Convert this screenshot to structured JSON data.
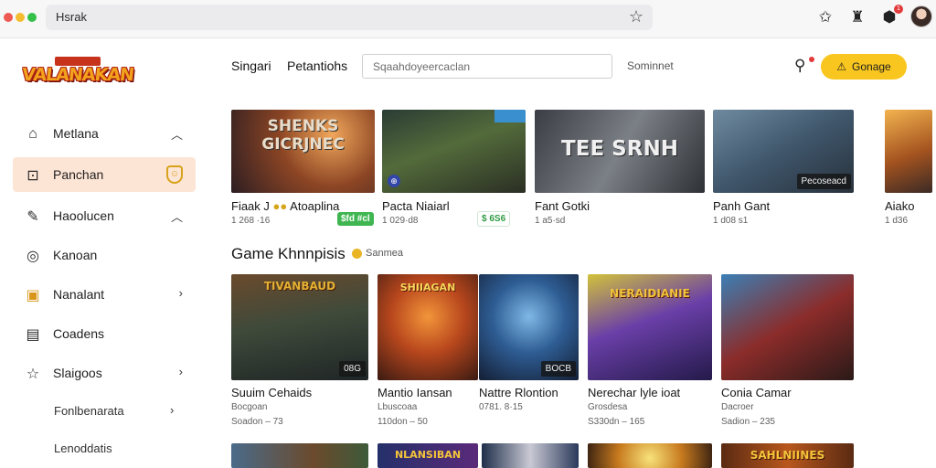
{
  "browser": {
    "url": "Hsrak",
    "notification_count": "1"
  },
  "logo": {
    "text": "VALANAKAN"
  },
  "sidebar": {
    "items": [
      {
        "label": "Metlana",
        "icon": "home-icon",
        "chevron": "up"
      },
      {
        "label": "Panchan",
        "icon": "bookmark-icon",
        "active": true,
        "badge_icon": "shield-icon"
      },
      {
        "label": "Haoolucen",
        "icon": "pen-icon",
        "chevron": "up"
      },
      {
        "label": "Kanoan",
        "icon": "disc-icon"
      },
      {
        "label": "Nanalant",
        "icon": "info-icon",
        "chevron": "right"
      },
      {
        "label": "Coadens",
        "icon": "document-icon"
      },
      {
        "label": "Slaigoos",
        "icon": "star-icon",
        "chevron": "right"
      }
    ],
    "subitems": [
      {
        "label": "Fonlbenarata",
        "chevron": "right"
      },
      {
        "label": "Lenoddatis"
      }
    ]
  },
  "nav": {
    "links": [
      "Singari",
      "Petantiohs"
    ],
    "search_placeholder": "Sqaahdoyeercaclan",
    "meta_text": "Sominnet",
    "cta_label": "Gonage"
  },
  "top_row": [
    {
      "thumb_title": "SHENKS\nGICRJNEC",
      "title": "Fiaak J",
      "extra_title": "Atoaplina",
      "meta": "1 268 ·16",
      "price": "$fd #cl",
      "price_style": "green"
    },
    {
      "title": "Pacta Niaiarl",
      "meta": "1 029·d8",
      "price": "$ 6S6",
      "price_style": "light"
    },
    {
      "thumb_title": "TEE SRNH",
      "title": "Fant Gotki",
      "meta": "1 a5·sd"
    },
    {
      "title": "Panh Gant",
      "meta": "1 d08 s1",
      "tag": "Pecoseacd"
    },
    {
      "title": "Aiako",
      "meta": "1 d36"
    }
  ],
  "section": {
    "title": "Game Khnnpisis",
    "tag": "Sanmea"
  },
  "grid_row": [
    {
      "thumb_title": "TIVANBAUD",
      "title": "Suuim Cehaids",
      "sub": "Bocgoan",
      "meta": "Soadon – 73",
      "tag": "08G"
    },
    {
      "thumb_title": "SHIIAGAN",
      "title": "Mantio Iansan",
      "sub": "Lbuscoaa",
      "meta": "110don – 50"
    },
    {
      "title": "Nattre Rlontion",
      "sub": "0781. 8·15",
      "tag": "BOCB"
    },
    {
      "thumb_title": "NERAIDIANIE",
      "title": "Nerechar lyle ioat",
      "sub": "Grosdesa",
      "meta": "S330dn – 165"
    },
    {
      "title": "Conia Camar",
      "sub": "Dacroer",
      "meta": "Sadion – 235"
    }
  ],
  "bottom_row": [
    {
      "thumb_title": ""
    },
    {
      "thumb_title": "NLANSIBAN"
    },
    {
      "thumb_title": ""
    },
    {
      "thumb_title": ""
    },
    {
      "thumb_title": "SAHLNIINES"
    }
  ]
}
